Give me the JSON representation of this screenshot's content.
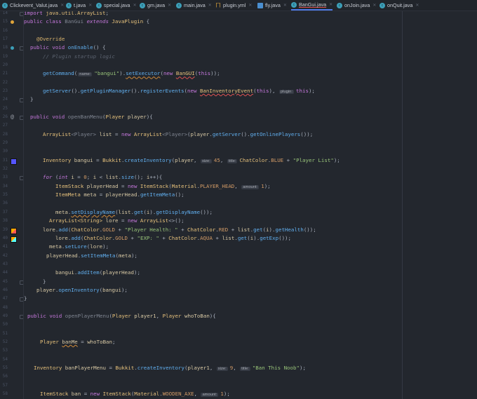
{
  "tabs": [
    {
      "label": "Clickevent_Valut.java",
      "icon": "java-class-icon"
    },
    {
      "label": "t.java",
      "icon": "java-class-icon"
    },
    {
      "label": "special.java",
      "icon": "java-class-icon"
    },
    {
      "label": "gm.java",
      "icon": "java-class-icon"
    },
    {
      "label": "main.java",
      "icon": "java-class-icon"
    },
    {
      "label": "plugin.yml",
      "icon": "yaml-file-icon"
    },
    {
      "label": "fly.java",
      "icon": "java-file-icon"
    },
    {
      "label": "BanGui.java",
      "icon": "java-class-icon",
      "active": true
    },
    {
      "label": "onJoin.java",
      "icon": "java-class-icon"
    },
    {
      "label": "onQuit.java",
      "icon": "java-class-icon"
    }
  ],
  "gutter_markers": {
    "15": {
      "icon": "run-plugin-icon",
      "color": "#e0a43a"
    },
    "18": {
      "icon": "override-method-icon",
      "color": "#3c9fb8"
    },
    "26": {
      "icon": "annotation-at-icon",
      "color": "#9aa0aa"
    },
    "31": {
      "icon": "color-swatch-icon",
      "color": "#5555ff"
    },
    "39": {
      "icon": "color-swatch-icon",
      "color": "#ffaa00",
      "color2": "#ff5555"
    },
    "40": {
      "icon": "color-swatch-icon",
      "color": "#ffaa00",
      "color2": "#55ffff"
    }
  },
  "code": {
    "lines": [
      {
        "n": "14",
        "tokens": [
          [
            "import ",
            "k"
          ],
          [
            "java.util.ArrayList",
            "t"
          ],
          [
            ";",
            "p"
          ]
        ]
      },
      {
        "n": "15",
        "tokens": [
          [
            "public class ",
            "k"
          ],
          [
            "BanGui ",
            "g"
          ],
          [
            "extends ",
            "ki"
          ],
          [
            "JavaPlugin ",
            "t"
          ],
          [
            "{",
            "p"
          ]
        ]
      },
      {
        "n": "16",
        "tokens": []
      },
      {
        "n": "17",
        "tokens": [
          [
            "@Override",
            "a"
          ]
        ]
      },
      {
        "n": "18",
        "tokens": [
          [
            "public void ",
            "k"
          ],
          [
            "onEnable",
            "f"
          ],
          [
            "() {",
            "p"
          ]
        ]
      },
      {
        "n": "19",
        "tokens": [
          [
            "// Plugin startup logic",
            "cm"
          ]
        ]
      },
      {
        "n": "20",
        "tokens": []
      },
      {
        "n": "21",
        "tokens": [
          [
            "getCommand",
            "f"
          ],
          [
            "(",
            "p"
          ],
          [
            "name:",
            "h"
          ],
          [
            "\"bangui\"",
            "s"
          ],
          [
            ").",
            "p"
          ],
          [
            "setExecutor",
            "fu"
          ],
          [
            "(",
            "p"
          ],
          [
            "new ",
            "k"
          ],
          [
            "BanGUI",
            "tu"
          ],
          [
            "(",
            "p"
          ],
          [
            "this",
            "k"
          ],
          [
            "));",
            "p"
          ]
        ]
      },
      {
        "n": "22",
        "tokens": []
      },
      {
        "n": "23",
        "tokens": [
          [
            "getServer",
            "f"
          ],
          [
            "().",
            "p"
          ],
          [
            "getPluginManager",
            "f"
          ],
          [
            "().",
            "p"
          ],
          [
            "registerEvents",
            "f"
          ],
          [
            "(",
            "p"
          ],
          [
            "new ",
            "k"
          ],
          [
            "BanInventoryEvent",
            "tu"
          ],
          [
            "(",
            "p"
          ],
          [
            "this",
            "k"
          ],
          "),",
          [
            "), ",
            "p"
          ],
          [
            "plugin:",
            "h"
          ],
          [
            "this",
            "k"
          ],
          [
            ");",
            "p"
          ]
        ]
      },
      {
        "n": "24",
        "tokens": [
          [
            "}",
            "p"
          ]
        ]
      },
      {
        "n": "25",
        "tokens": []
      },
      {
        "n": "26",
        "tokens": [
          [
            "public void ",
            "k"
          ],
          [
            "openBanMenu",
            "g"
          ],
          [
            "(",
            "p"
          ],
          [
            "Player ",
            "t"
          ],
          [
            "player",
            "v"
          ],
          [
            "){",
            "p"
          ]
        ]
      },
      {
        "n": "27",
        "tokens": []
      },
      {
        "n": "28",
        "tokens": [
          [
            "ArrayList",
            "t"
          ],
          [
            "<Player> ",
            "g"
          ],
          [
            "list",
            "v"
          ],
          [
            " = ",
            "p"
          ],
          [
            "new ",
            "k"
          ],
          [
            "ArrayList",
            "t"
          ],
          [
            "<Player>",
            "g"
          ],
          [
            "(",
            "p"
          ],
          [
            "player",
            "v"
          ],
          [
            ".",
            "p"
          ],
          [
            "getServer",
            "f"
          ],
          [
            "().",
            "p"
          ],
          [
            "getOnlinePlayers",
            "f"
          ],
          [
            "());",
            "p"
          ]
        ]
      },
      {
        "n": "29",
        "tokens": []
      },
      {
        "n": "30",
        "tokens": []
      },
      {
        "n": "31",
        "tokens": [
          [
            "Inventory ",
            "t"
          ],
          [
            "bangui",
            "v"
          ],
          [
            " = ",
            "p"
          ],
          [
            "Bukkit",
            "t"
          ],
          [
            ".",
            "p"
          ],
          [
            "createInventory",
            "f"
          ],
          [
            "(",
            "p"
          ],
          [
            "player",
            "v"
          ],
          [
            ", ",
            "p"
          ],
          [
            "size:",
            "h"
          ],
          [
            "45",
            "c"
          ],
          [
            ", ",
            "p"
          ],
          [
            "title:",
            "h"
          ],
          [
            "ChatColor",
            "t"
          ],
          [
            ".",
            "p"
          ],
          [
            "BLUE",
            "c"
          ],
          [
            " + ",
            "p"
          ],
          [
            "\"Player List\"",
            "s"
          ],
          [
            ");",
            "p"
          ]
        ]
      },
      {
        "n": "32",
        "tokens": []
      },
      {
        "n": "33",
        "tokens": [
          [
            "for",
            "ki"
          ],
          [
            " (",
            "p"
          ],
          [
            "int ",
            "ki"
          ],
          [
            "i",
            "v"
          ],
          [
            " = ",
            "p"
          ],
          [
            "0",
            "c"
          ],
          [
            "; ",
            "p"
          ],
          [
            "i",
            "v"
          ],
          [
            " < ",
            "p"
          ],
          [
            "list",
            "v"
          ],
          [
            ".",
            "p"
          ],
          [
            "size",
            "f"
          ],
          [
            "(); ",
            "p"
          ],
          [
            "i",
            "v"
          ],
          [
            "++){",
            "p"
          ]
        ]
      },
      {
        "n": "34",
        "tokens": [
          [
            "ItemStack ",
            "t"
          ],
          [
            "playerHead",
            "v"
          ],
          [
            " = ",
            "p"
          ],
          [
            "new ",
            "k"
          ],
          [
            "ItemStack",
            "t"
          ],
          [
            "(",
            "p"
          ],
          [
            "Material",
            "t"
          ],
          [
            ".",
            "p"
          ],
          [
            "PLAYER_HEAD",
            "c"
          ],
          [
            ", ",
            "p"
          ],
          [
            "amount:",
            "h"
          ],
          [
            "1",
            "c"
          ],
          [
            ");",
            "p"
          ]
        ]
      },
      {
        "n": "35",
        "tokens": [
          [
            "ItemMeta ",
            "t"
          ],
          [
            "meta",
            "v"
          ],
          [
            " = ",
            "p"
          ],
          [
            "playerHead",
            "v"
          ],
          [
            ".",
            "p"
          ],
          [
            "getItemMeta",
            "f"
          ],
          [
            "();",
            "p"
          ]
        ]
      },
      {
        "n": "36",
        "tokens": []
      },
      {
        "n": "37",
        "tokens": [
          [
            "meta",
            "v"
          ],
          [
            ".",
            "p"
          ],
          [
            "setDisplayName",
            "fu"
          ],
          [
            "(",
            "p"
          ],
          [
            "list",
            "v"
          ],
          [
            ".",
            "p"
          ],
          [
            "get",
            "f"
          ],
          [
            "(",
            "p"
          ],
          [
            "i",
            "v"
          ],
          [
            ").",
            "p"
          ],
          [
            "getDisplayName",
            "f"
          ],
          [
            "());",
            "p"
          ]
        ]
      },
      {
        "n": "38",
        "tokens": [
          [
            "ArrayList",
            "t"
          ],
          [
            "<String> ",
            "t"
          ],
          [
            "lore",
            "v"
          ],
          [
            " = ",
            "p"
          ],
          [
            "new ",
            "k"
          ],
          [
            "ArrayList",
            "t"
          ],
          [
            "<>();",
            "p"
          ]
        ]
      },
      {
        "n": "39",
        "tokens": [
          [
            "lore",
            "v"
          ],
          [
            ".",
            "p"
          ],
          [
            "add",
            "f"
          ],
          [
            "(",
            "p"
          ],
          [
            "ChatColor",
            "t"
          ],
          [
            ".",
            "p"
          ],
          [
            "GOLD",
            "c"
          ],
          [
            " + ",
            "p"
          ],
          [
            "\"Player Health: \"",
            "s"
          ],
          [
            " + ",
            "p"
          ],
          [
            "ChatColor",
            "t"
          ],
          [
            ".",
            "p"
          ],
          [
            "RED",
            "c"
          ],
          [
            " + ",
            "p"
          ],
          [
            "list",
            "v"
          ],
          [
            ".",
            "p"
          ],
          [
            "get",
            "f"
          ],
          [
            "(",
            "p"
          ],
          [
            "i",
            "v"
          ],
          [
            ").",
            "p"
          ],
          [
            "getHealth",
            "f"
          ],
          [
            "());",
            "p"
          ]
        ]
      },
      {
        "n": "40",
        "tokens": [
          [
            "lore",
            "v"
          ],
          [
            ".",
            "p"
          ],
          [
            "add",
            "f"
          ],
          [
            "(",
            "p"
          ],
          [
            "ChatColor",
            "t"
          ],
          [
            ".",
            "p"
          ],
          [
            "GOLD",
            "c"
          ],
          [
            " + ",
            "p"
          ],
          [
            "\"EXP: \"",
            "s"
          ],
          [
            " + ",
            "p"
          ],
          [
            "ChatColor",
            "t"
          ],
          [
            ".",
            "p"
          ],
          [
            "AQUA",
            "c"
          ],
          [
            " + ",
            "p"
          ],
          [
            "list",
            "v"
          ],
          [
            ".",
            "p"
          ],
          [
            "get",
            "f"
          ],
          [
            "(",
            "p"
          ],
          [
            "i",
            "v"
          ],
          [
            ").",
            "p"
          ],
          [
            "getExp",
            "f"
          ],
          [
            "());",
            "p"
          ]
        ]
      },
      {
        "n": "41",
        "tokens": [
          [
            "meta",
            "v"
          ],
          [
            ".",
            "p"
          ],
          [
            "setLore",
            "f"
          ],
          [
            "(",
            "p"
          ],
          [
            "lore",
            "v"
          ],
          [
            ");",
            "p"
          ]
        ]
      },
      {
        "n": "42",
        "tokens": [
          [
            "playerHead",
            "v"
          ],
          [
            ".",
            "p"
          ],
          [
            "setItemMeta",
            "f"
          ],
          [
            "(",
            "p"
          ],
          [
            "meta",
            "v"
          ],
          [
            ");",
            "p"
          ]
        ]
      },
      {
        "n": "43",
        "tokens": []
      },
      {
        "n": "44",
        "tokens": [
          [
            "bangui",
            "v"
          ],
          [
            ".",
            "p"
          ],
          [
            "addItem",
            "f"
          ],
          [
            "(",
            "p"
          ],
          [
            "playerHead",
            "v"
          ],
          [
            ");",
            "p"
          ]
        ]
      },
      {
        "n": "45",
        "tokens": [
          [
            "}",
            "p"
          ]
        ]
      },
      {
        "n": "46",
        "tokens": [
          [
            "player",
            "v"
          ],
          [
            ".",
            "p"
          ],
          [
            "openInventory",
            "f"
          ],
          [
            "(",
            "p"
          ],
          [
            "bangui",
            "v"
          ],
          [
            ");",
            "p"
          ]
        ]
      },
      {
        "n": "47",
        "tokens": [
          [
            "}",
            "p"
          ]
        ]
      },
      {
        "n": "48",
        "tokens": []
      },
      {
        "n": "49",
        "tokens": [
          [
            "public void ",
            "k"
          ],
          [
            "openPlayerMenu",
            "g"
          ],
          [
            "(",
            "p"
          ],
          [
            "Player ",
            "t"
          ],
          [
            "player1",
            "v"
          ],
          [
            ", ",
            "p"
          ],
          [
            "Player ",
            "t"
          ],
          [
            "whoToBan",
            "v"
          ],
          [
            "){",
            "p"
          ]
        ]
      },
      {
        "n": "50",
        "tokens": []
      },
      {
        "n": "51",
        "tokens": []
      },
      {
        "n": "52",
        "tokens": [
          [
            "Player ",
            "t"
          ],
          [
            "banMe",
            "vu"
          ],
          [
            " = ",
            "p"
          ],
          [
            "whoToBan",
            "v"
          ],
          [
            ";",
            "p"
          ]
        ]
      },
      {
        "n": "53",
        "tokens": []
      },
      {
        "n": "54",
        "tokens": []
      },
      {
        "n": "55",
        "tokens": [
          [
            "Inventory ",
            "t"
          ],
          [
            "banPlayerMenu",
            "v"
          ],
          [
            " = ",
            "p"
          ],
          [
            "Bukkit",
            "t"
          ],
          [
            ".",
            "p"
          ],
          [
            "createInventory",
            "f"
          ],
          [
            "(",
            "p"
          ],
          [
            "player1",
            "v"
          ],
          [
            ", ",
            "p"
          ],
          [
            "size:",
            "h"
          ],
          [
            "9",
            "c"
          ],
          [
            ", ",
            "p"
          ],
          [
            "title:",
            "h"
          ],
          [
            "\"Ban This Noob\"",
            "s"
          ],
          [
            ");",
            "p"
          ]
        ]
      },
      {
        "n": "56",
        "tokens": []
      },
      {
        "n": "57",
        "tokens": []
      },
      {
        "n": "58",
        "tokens": [
          [
            "ItemStack ",
            "t"
          ],
          [
            "ban",
            "v"
          ],
          [
            " = ",
            "p"
          ],
          [
            "new ",
            "k"
          ],
          [
            "ItemStack",
            "t"
          ],
          [
            "(",
            "p"
          ],
          [
            "Material",
            "t"
          ],
          [
            ".",
            "p"
          ],
          [
            "WOODEN_AXE",
            "c"
          ],
          [
            ", ",
            "p"
          ],
          [
            "amount:",
            "h"
          ],
          [
            "1",
            "c"
          ],
          [
            ");",
            "p"
          ]
        ]
      }
    ]
  }
}
